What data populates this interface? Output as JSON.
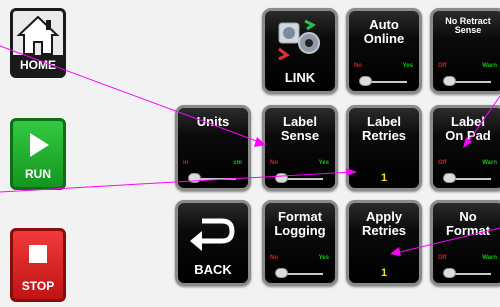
{
  "side_buttons": {
    "home": {
      "label": "HOME"
    },
    "run": {
      "label": "RUN"
    },
    "stop": {
      "label": "STOP"
    }
  },
  "tiles": {
    "link": {
      "label": "LINK"
    },
    "auto_online": {
      "title": "Auto\nOnline",
      "off": "No",
      "on": "Yes"
    },
    "no_retract_sense": {
      "title": "No Retract\nSense",
      "off": "Off",
      "on": "Warn"
    },
    "units": {
      "title": "Units",
      "off": "in",
      "on": "cm"
    },
    "label_sense": {
      "title": "Label\nSense",
      "off": "No",
      "on": "Yes"
    },
    "label_retries": {
      "title": "Label\nRetries",
      "value": "1"
    },
    "label_onpad": {
      "title": "Label\nOn Pad",
      "off": "Off",
      "on": "Warn"
    },
    "back": {
      "label": "BACK"
    },
    "format_logging": {
      "title": "Format\nLogging",
      "off": "No",
      "on": "Yes"
    },
    "apply_retries": {
      "title": "Apply\nRetries",
      "value": "1"
    },
    "no_format": {
      "title": "No\nFormat",
      "off": "Off",
      "on": "Warn"
    }
  },
  "colors": {
    "home": "#c7c7c7",
    "run": "#1fae2c",
    "stop": "#e02020",
    "callout": "#ff00ff",
    "value": "#f5e11a"
  }
}
